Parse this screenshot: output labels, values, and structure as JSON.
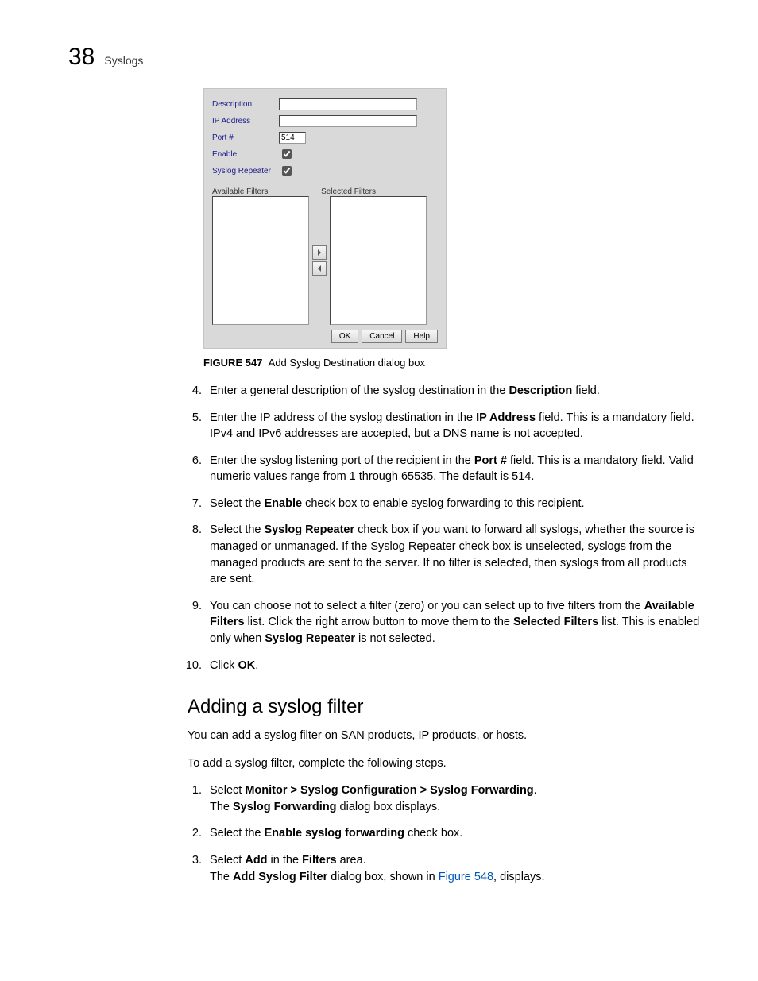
{
  "header": {
    "num": "38",
    "title": "Syslogs"
  },
  "dialog": {
    "labels": {
      "description": "Description",
      "ip": "IP Address",
      "port": "Port #",
      "enable": "Enable",
      "repeater": "Syslog Repeater",
      "avail": "Available Filters",
      "sel": "Selected Filters"
    },
    "values": {
      "port": "514"
    },
    "buttons": {
      "ok": "OK",
      "cancel": "Cancel",
      "help": "Help"
    }
  },
  "figure": {
    "num": "FIGURE 547",
    "caption": "Add Syslog Destination dialog box"
  },
  "steps": {
    "s4": {
      "t1": "Enter a general description of the syslog destination in the ",
      "b1": "Description",
      "t2": " field."
    },
    "s5": {
      "t1": "Enter the IP address of the syslog destination in the ",
      "b1": "IP Address",
      "t2": " field. This is a mandatory field. IPv4 and IPv6 addresses are accepted, but a DNS name is not accepted."
    },
    "s6": {
      "t1": "Enter the syslog listening port of the recipient in the ",
      "b1": "Port #",
      "t2": " field. This is a mandatory field. Valid numeric values range from 1 through 65535. The default is 514."
    },
    "s7": {
      "t1": "Select the ",
      "b1": "Enable",
      "t2": " check box to enable syslog forwarding to this recipient."
    },
    "s8": {
      "t1": "Select the ",
      "b1": "Syslog Repeater",
      "t2": " check box if you want to forward all syslogs, whether the source is managed or unmanaged. If the Syslog Repeater check box is unselected, syslogs from the managed products are sent to the server. If no filter is selected, then syslogs from all products are sent."
    },
    "s9": {
      "t1": "You can choose not to select a filter (zero) or you can select up to five filters from the ",
      "b1": "Available Filters",
      "t2": " list. Click the right arrow button to move them to the ",
      "b2": "Selected Filters",
      "t3": " list. This is enabled only when ",
      "b3": "Syslog Repeater",
      "t4": " is not selected."
    },
    "s10": {
      "t1": "Click ",
      "b1": "OK",
      "t2": "."
    }
  },
  "section2": {
    "heading": "Adding a syslog filter",
    "intro1": "You can add a syslog filter on SAN products, IP products, or hosts.",
    "intro2": "To add a syslog filter, complete the following steps.",
    "s1": {
      "t1": "Select ",
      "b1": "Monitor > Syslog Configuration > Syslog Forwarding",
      "t2": ".",
      "sub_t1": "The ",
      "sub_b1": "Syslog Forwarding",
      "sub_t2": " dialog box displays."
    },
    "s2": {
      "t1": "Select the ",
      "b1": "Enable syslog forwarding",
      "t2": " check box."
    },
    "s3": {
      "t1": "Select ",
      "b1": "Add",
      "t2": " in the ",
      "b2": "Filters",
      "t3": " area.",
      "sub_t1": "The ",
      "sub_b1": "Add Syslog Filter",
      "sub_t2": " dialog box, shown in ",
      "sub_link": "Figure 548",
      "sub_t3": ", displays."
    }
  }
}
